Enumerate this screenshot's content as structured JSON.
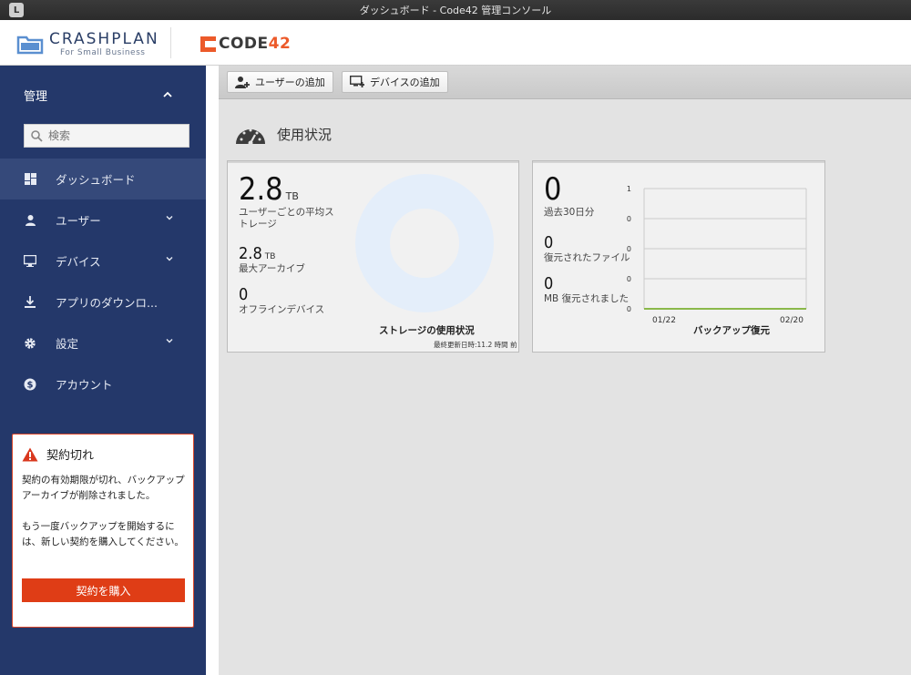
{
  "window": {
    "title": "ダッシュボード - Code42 管理コンソール",
    "app_icon_letter": "L"
  },
  "header": {
    "crashplan_name": "CRASHPLAN",
    "crashplan_sub": "For Small Business",
    "code42_text": "CODE",
    "code42_number": "42"
  },
  "sidebar": {
    "section_title": "管理",
    "search_placeholder": "検索",
    "items": [
      {
        "label": "ダッシュボード",
        "icon": "dashboard-icon"
      },
      {
        "label": "ユーザー",
        "icon": "user-icon"
      },
      {
        "label": "デバイス",
        "icon": "monitor-icon"
      },
      {
        "label": "アプリのダウンロ...",
        "icon": "download-icon"
      },
      {
        "label": "設定",
        "icon": "gear-icon"
      },
      {
        "label": "アカウント",
        "icon": "dollar-icon"
      }
    ],
    "alert": {
      "title": "契約切れ",
      "message1": "契約の有効期限が切れ、バックアップアーカイブが削除されました。",
      "message2": "もう一度バックアップを開始するには、新しい契約を購入してください。",
      "button": "契約を購入"
    }
  },
  "toolbar": {
    "add_user": "ユーザーの追加",
    "add_device": "デバイスの追加"
  },
  "main": {
    "section_title": "使用状況",
    "storage_card": {
      "avg_value": "2.8",
      "avg_unit": "TB",
      "avg_label": "ユーザーごとの平均ストレージ",
      "max_value": "2.8",
      "max_unit": "TB",
      "max_label": "最大アーカイブ",
      "offline_value": "0",
      "offline_label": "オフラインデバイス",
      "title": "ストレージの使用状況",
      "updated": "最終更新日時:11.2 時間 前"
    },
    "restore_card": {
      "days_value": "0",
      "days_label": "過去30日分",
      "files_value": "0",
      "files_label": "復元されたファイル",
      "mb_value": "0",
      "mb_label": "MB 復元されました",
      "title": "バックアップ復元"
    }
  },
  "chart_data": {
    "type": "line",
    "title": "バックアップ復元",
    "x_ticks": [
      "01/22",
      "02/20"
    ],
    "y_ticks": [
      "1",
      "0",
      "0",
      "0",
      "0"
    ],
    "ylim": [
      0,
      1
    ],
    "series": [
      {
        "values": [
          0,
          0
        ]
      }
    ],
    "colors": {
      "line": "#8ab84a",
      "grid": "#cccccc"
    }
  }
}
